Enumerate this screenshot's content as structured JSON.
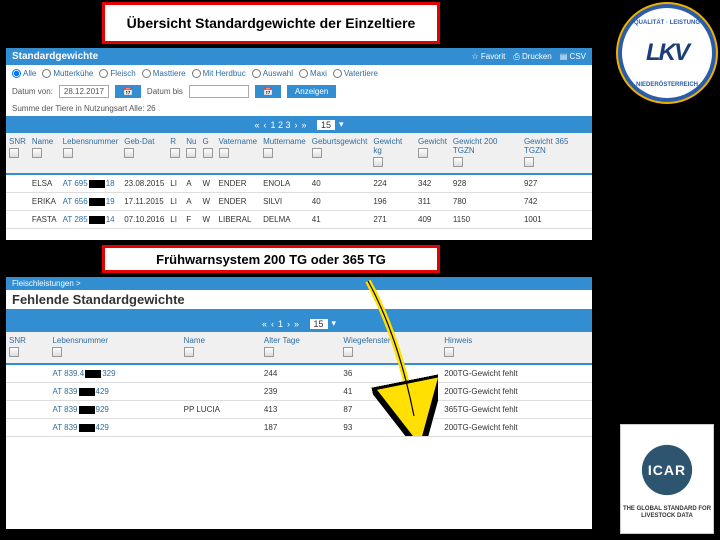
{
  "logo": {
    "text": "LKV",
    "top": "QUALITÄT · LEISTUNG",
    "bot": "NIEDERÖSTERREICH"
  },
  "banner1": "Übersicht Standardgewichte der Einzeltiere",
  "banner2": "Frühwarnsystem 200 TG oder 365 TG",
  "p1": {
    "title": "Standardgewichte",
    "actions": {
      "fav": "☆ Favorit",
      "print": "⎙ Drucken",
      "csv": "▤ CSV"
    },
    "radios": [
      "Alle",
      "Mutterkühe",
      "Fleisch",
      "Masttiere",
      "Mit Herdbuc",
      "Auswahl",
      "Maxi",
      "Vatertiere"
    ],
    "date_lbl": "Datum von:",
    "date_val": "28.12.2017",
    "date_lbl2": "Datum bis",
    "show": "Anzeigen",
    "sum": "Summe der Tiere in Nutzungsart Alle: 26",
    "pager": {
      "pages": "1 2 3",
      "size": "15"
    },
    "cols": [
      "SNR",
      "Name",
      "Lebensnummer",
      "Geb-Dat",
      "R",
      "Nu",
      "G",
      "Vatername",
      "Muttername",
      "Geburtsgewicht",
      "Gewicht kg",
      "Gewicht",
      "Gewicht 200 TGZN",
      "Gewicht 365 TGZN"
    ],
    "rows": [
      {
        "name": "ELSA",
        "ln": "AT 695…18",
        "geb": "23.08.2015",
        "r": "LI",
        "nu": "A",
        "g": "W",
        "vat": "ENDER",
        "mut": "ENOLA",
        "gg": "40",
        "g1": "224",
        "g2": "342",
        "g200": "928",
        "g365": "927"
      },
      {
        "name": "ERIKA",
        "ln": "AT 656…19",
        "geb": "17.11.2015",
        "r": "LI",
        "nu": "A",
        "g": "W",
        "vat": "ENDER",
        "mut": "SILVI",
        "gg": "40",
        "g1": "196",
        "g2": "311",
        "g200": "780",
        "g365": "742"
      },
      {
        "name": "FASTA",
        "ln": "AT 285…14",
        "geb": "07.10.2016",
        "r": "LI",
        "nu": "F",
        "g": "W",
        "vat": "LIBERAL",
        "mut": "DELMA",
        "gg": "41",
        "g1": "271",
        "g2": "409",
        "g200": "1150",
        "g365": "1001"
      }
    ]
  },
  "p2": {
    "crumb": "Fleischleistungen >",
    "title": "Fehlende Standardgewichte",
    "pager": {
      "pages": "1",
      "size": "15"
    },
    "cols": [
      "SNR",
      "Lebensnummer",
      "Name",
      "Alter Tage",
      "Wiegefenster",
      "Hinweis"
    ],
    "rows": [
      {
        "ln": "AT 839.4…329",
        "name": "",
        "alt": "244",
        "wf": "36",
        "hin": "200TG-Gewicht fehlt"
      },
      {
        "ln": "AT 839…429",
        "name": "",
        "alt": "239",
        "wf": "41",
        "hin": "200TG-Gewicht fehlt"
      },
      {
        "ln": "AT 839…929",
        "name": "PP LUCIA",
        "alt": "413",
        "wf": "87",
        "hin": "365TG-Gewicht fehlt"
      },
      {
        "ln": "AT 839…429",
        "name": "",
        "alt": "187",
        "wf": "93",
        "hin": "200TG-Gewicht fehlt"
      }
    ]
  },
  "icar": {
    "txt": "ICAR",
    "sub": "THE GLOBAL STANDARD FOR LIVESTOCK DATA"
  }
}
